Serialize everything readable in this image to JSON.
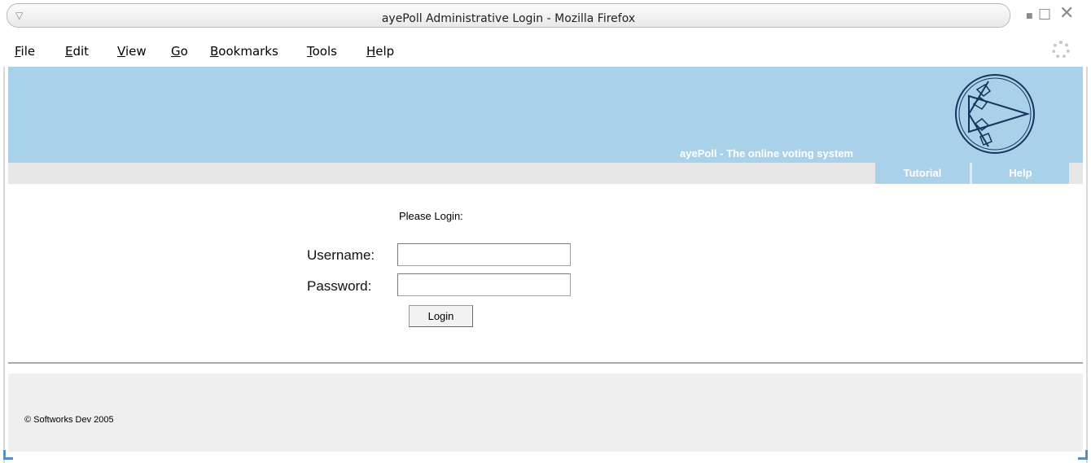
{
  "window": {
    "title": "ayePoll Administrative Login - Mozilla Firefox"
  },
  "menubar": {
    "items": [
      {
        "label": "File"
      },
      {
        "label": "Edit"
      },
      {
        "label": "View"
      },
      {
        "label": "Go"
      },
      {
        "label": "Bookmarks"
      },
      {
        "label": "Tools"
      },
      {
        "label": "Help"
      }
    ]
  },
  "header": {
    "tagline": "ayePoll - The online voting system",
    "nav": [
      {
        "label": "Tutorial"
      },
      {
        "label": "Help"
      }
    ],
    "banner_color": "#a9d1ea"
  },
  "login": {
    "prompt": "Please Login:",
    "username_label": "Username:",
    "username_value": "",
    "password_label": "Password:",
    "password_value": "",
    "submit_label": "Login"
  },
  "footer": {
    "copyright": "© Softworks Dev 2005"
  },
  "icons": {
    "window_menu": "triangle-down-icon",
    "minimize": "minimize-icon",
    "maximize": "maximize-icon",
    "close": "close-icon",
    "throbber": "throbber-icon",
    "logo": "ayepoll-logo"
  }
}
